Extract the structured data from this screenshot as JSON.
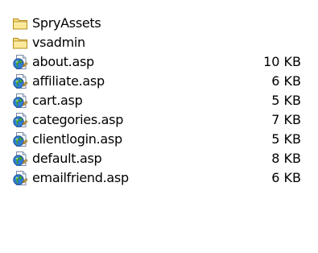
{
  "items": [
    {
      "name": "SpryAssets",
      "size": "",
      "type": "folder",
      "icon": "folder-icon"
    },
    {
      "name": "vsadmin",
      "size": "",
      "type": "folder",
      "icon": "folder-icon"
    },
    {
      "name": "about.asp",
      "size": "10 KB",
      "type": "asp",
      "icon": "asp-file-icon"
    },
    {
      "name": "affiliate.asp",
      "size": "6 KB",
      "type": "asp",
      "icon": "asp-file-icon"
    },
    {
      "name": "cart.asp",
      "size": "5 KB",
      "type": "asp",
      "icon": "asp-file-icon"
    },
    {
      "name": "categories.asp",
      "size": "7 KB",
      "type": "asp",
      "icon": "asp-file-icon"
    },
    {
      "name": "clientlogin.asp",
      "size": "5 KB",
      "type": "asp",
      "icon": "asp-file-icon"
    },
    {
      "name": "default.asp",
      "size": "8 KB",
      "type": "asp",
      "icon": "asp-file-icon"
    },
    {
      "name": "emailfriend.asp",
      "size": "6 KB",
      "type": "asp",
      "icon": "asp-file-icon"
    }
  ]
}
